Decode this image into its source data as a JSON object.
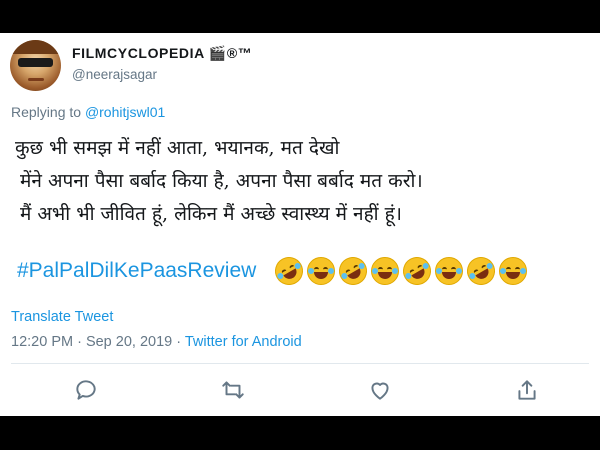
{
  "tweet": {
    "display_name": "FILMCYCLOPEDIA 🎬®™",
    "handle": "@neerajsagar",
    "replying_prefix": "Replying to ",
    "replying_to": "@rohitjswl01",
    "lines": [
      "कुछ भी समझ में नहीं आता, भयानक, मत देखो",
      "मेंने अपना पैसा बर्बाद किया है, अपना पैसा बर्बाद मत करो।",
      "मैं अभी भी जीवित हूं, लेकिन मैं अच्छे स्वास्थ्य में नहीं हूं।"
    ],
    "hashtag": "#PalPalDilKePaasReview",
    "emojis": [
      "rolling-on-floor-laughing",
      "tears-of-joy",
      "rolling-on-floor-laughing",
      "tears-of-joy",
      "rolling-on-floor-laughing",
      "tears-of-joy",
      "rolling-on-floor-laughing",
      "tears-of-joy"
    ],
    "translate_label": "Translate Tweet",
    "timestamp": "12:20 PM · Sep 20, 2019 · ",
    "source": "Twitter for Android"
  },
  "actions": [
    "reply-icon",
    "retweet-icon",
    "like-icon",
    "share-icon"
  ],
  "colors": {
    "link": "#1b95e0",
    "muted": "#657786",
    "text": "#14171a"
  }
}
